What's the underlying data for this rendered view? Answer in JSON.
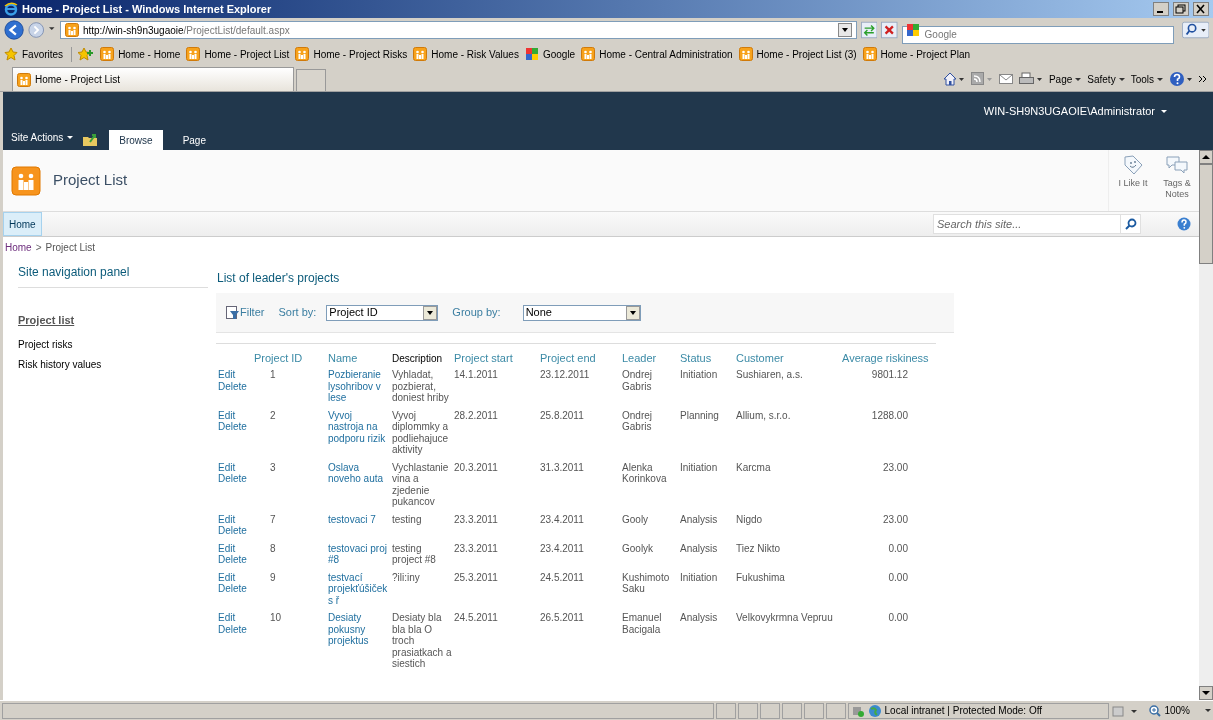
{
  "window": {
    "title": "Home - Project List - Windows Internet Explorer"
  },
  "address_bar": {
    "url_host": "http://win-sh9n3ugaoie",
    "url_path": "/ProjectList/default.aspx",
    "search_placeholder": "Google"
  },
  "favorites": {
    "label": "Favorites",
    "items": [
      {
        "label": "Home - Home",
        "kind": "site"
      },
      {
        "label": "Home - Project List",
        "kind": "site"
      },
      {
        "label": "Home - Project Risks",
        "kind": "site"
      },
      {
        "label": "Home - Risk Values",
        "kind": "site"
      },
      {
        "label": "Google",
        "kind": "google"
      },
      {
        "label": "Home - Central Administration",
        "kind": "site"
      },
      {
        "label": "Home - Project List (3)",
        "kind": "site"
      },
      {
        "label": "Home - Project Plan",
        "kind": "site"
      }
    ]
  },
  "tabs": [
    {
      "label": "Home - Project List",
      "selected": true
    }
  ],
  "command_bar": [
    "Page",
    "Safety",
    "Tools"
  ],
  "ribbon": {
    "site_actions": "Site Actions",
    "tabs": [
      {
        "label": "Browse",
        "selected": true
      },
      {
        "label": "Page",
        "selected": false
      }
    ],
    "user": "WIN-SH9N3UGAOIE\\Administrator"
  },
  "site": {
    "title": "Project List",
    "actions": [
      {
        "label": "I Like It",
        "kind": "like"
      },
      {
        "label": "Tags & Notes",
        "kind": "tags"
      }
    ]
  },
  "top_nav": {
    "items": [
      {
        "label": "Home",
        "selected": true
      }
    ],
    "search_placeholder": "Search this site..."
  },
  "breadcrumb": {
    "items": [
      "Home",
      "Project List"
    ],
    "separator": ">"
  },
  "sidebar": {
    "heading": "Site navigation panel",
    "items": [
      {
        "label": "Project list",
        "selected": true
      },
      {
        "label": "Project risks",
        "selected": false
      },
      {
        "label": "Risk history values",
        "selected": false
      }
    ]
  },
  "list": {
    "title": "List of leader's projects",
    "toolbar": {
      "filter": "Filter",
      "sort_label": "Sort by:",
      "sort_value": "Project ID",
      "group_label": "Group by:",
      "group_value": "None"
    },
    "columns": [
      {
        "label": "Project ID",
        "sortable": true
      },
      {
        "label": "Name",
        "sortable": true
      },
      {
        "label": "Description",
        "sortable": false
      },
      {
        "label": "Project start",
        "sortable": true
      },
      {
        "label": "Project end",
        "sortable": true
      },
      {
        "label": "Leader",
        "sortable": true
      },
      {
        "label": "Status",
        "sortable": true
      },
      {
        "label": "Customer",
        "sortable": true
      },
      {
        "label": "Average riskiness",
        "sortable": true
      }
    ],
    "rows": [
      {
        "actions": [
          "Edit",
          "Delete"
        ],
        "cells": [
          "1",
          "Pozbieranie lysohribov v lese",
          "Vyhladat, pozbierat, doniest hriby",
          "14.1.2011",
          "23.12.2011",
          "Ondrej Gabris",
          "Initiation",
          "Sushiaren, a.s.",
          "9801.12"
        ]
      },
      {
        "actions": [
          "Edit",
          "Delete"
        ],
        "cells": [
          "2",
          "Vyvoj nastroja na podporu rizik",
          "Vyvoj diplommky a podliehajuce aktivity",
          "28.2.2011",
          "25.8.2011",
          "Ondrej Gabris",
          "Planning",
          "Allium, s.r.o.",
          "1288.00"
        ]
      },
      {
        "actions": [
          "Edit",
          "Delete"
        ],
        "cells": [
          "3",
          "Oslava noveho auta",
          "Vychlastanie vina a zjedenie pukancov",
          "20.3.2011",
          "31.3.2011",
          "Alenka Korinkova",
          "Initiation",
          "Karcma",
          "23.00"
        ]
      },
      {
        "actions": [
          "Edit",
          "Delete"
        ],
        "cells": [
          "7",
          "testovaci 7",
          "testing",
          "23.3.2011",
          "23.4.2011",
          "Gooly",
          "Analysis",
          "Nigdo",
          "23.00"
        ]
      },
      {
        "actions": [
          "Edit",
          "Delete"
        ],
        "cells": [
          "8",
          "testovaci proj #8",
          "testing project #8",
          "23.3.2011",
          "23.4.2011",
          "Goolyk",
          "Analysis",
          "Tiez Nikto",
          "0.00"
        ]
      },
      {
        "actions": [
          "Edit",
          "Delete"
        ],
        "cells": [
          "9",
          "testvací projekťúšiček s ř",
          "?ili:iny",
          "25.3.2011",
          "24.5.2011",
          "Kushimoto Saku",
          "Initiation",
          "Fukushima",
          "0.00"
        ]
      },
      {
        "actions": [
          "Edit",
          "Delete"
        ],
        "cells": [
          "10",
          "Desiaty pokusny projektus",
          "Desiaty bla bla bla O troch prasiatkach a siestich",
          "24.5.2011",
          "26.5.2011",
          "Emanuel Bacigala",
          "Analysis",
          "Velkovykrmna Vepruu",
          "0.00"
        ]
      }
    ]
  },
  "status_bar": {
    "zone": "Local intranet | Protected Mode: Off",
    "zoom": "100%"
  }
}
